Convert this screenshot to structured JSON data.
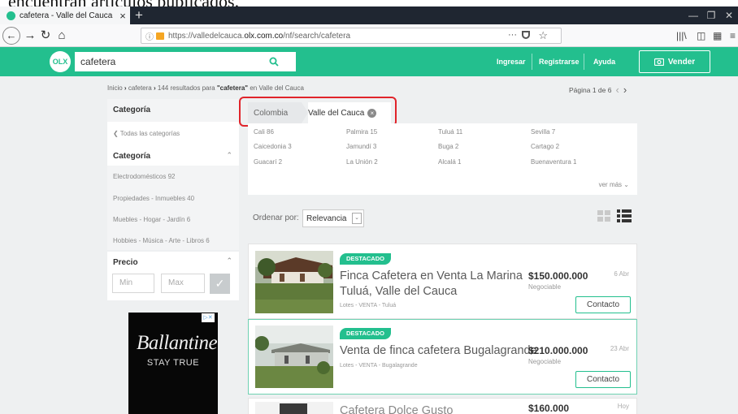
{
  "caption": "encuentran artículos publicados.",
  "browser": {
    "tab_title": "cafetera - Valle del Cauca",
    "url_prefix": "https://valledelcauca.",
    "url_domain": "olx.com.co",
    "url_path": "/nf/search/cafetera",
    "url_menu": "···"
  },
  "header": {
    "logo": "OLX",
    "search_value": "cafetera",
    "ingresar": "Ingresar",
    "registrarse": "Registrarse",
    "ayuda": "Ayuda",
    "vender": "Vender",
    "brand_color": "#23bf8e"
  },
  "breadcrumb": {
    "home": "Inicio",
    "sep": "›",
    "term": "cafetera",
    "results_prefix": "144 resultados para",
    "results_term": "\"cafetera\"",
    "results_suffix": "en Valle del Cauca"
  },
  "pagination": "Página 1 de 6",
  "sidebar": {
    "categoria_header": "Categoría",
    "all_categories": "Todas las categorías",
    "categoria_title": "Categoría",
    "categories": [
      "Electrodomésticos 92",
      "Propiedades - Inmuebles 40",
      "Muebles - Hogar - Jardín 6",
      "Hobbies - Música - Arte - Libros 6"
    ],
    "precio_title": "Precio",
    "min_placeholder": "Min",
    "max_placeholder": "Max"
  },
  "ad": {
    "brand": "Ballantine's",
    "tagline": "STAY TRUE"
  },
  "locations": {
    "country": "Colombia",
    "region": "Valle del Cauca"
  },
  "cities": [
    [
      "Cali 86",
      "Palmira 15",
      "Tuluá 11",
      "Sevilla 7"
    ],
    [
      "Caicedonia 3",
      "Jamundí 3",
      "Buga 2",
      "Cartago 2"
    ],
    [
      "Guacarí 2",
      "La Unión 2",
      "Alcalá 1",
      "Buenaventura 1"
    ]
  ],
  "ver_mas": "ver más",
  "sort": {
    "label": "Ordenar por:",
    "value": "Relevancia"
  },
  "listings": [
    {
      "badge": "DESTACADO",
      "title_line1": "Finca Cafetera en Venta La Marina",
      "title_line2": "Tuluá, Valle del Cauca",
      "meta": "Lotes - VENTA - Tuluá",
      "price": "$150.000.000",
      "negotiable": "Negociable",
      "date": "6 Abr",
      "contact": "Contacto"
    },
    {
      "badge": "DESTACADO",
      "title_line1": "Venta de finca cafetera Bugalagrande",
      "title_line2": "",
      "meta": "Lotes - VENTA - Bugalagrande",
      "price": "$210.000.000",
      "negotiable": "Negociable",
      "date": "23 Abr",
      "contact": "Contacto"
    },
    {
      "badge": "",
      "title_line1": "Cafetera Dolce Gusto",
      "title_line2": "",
      "meta": "",
      "price": "$160.000",
      "negotiable": "",
      "date": "Hoy",
      "contact": ""
    }
  ]
}
